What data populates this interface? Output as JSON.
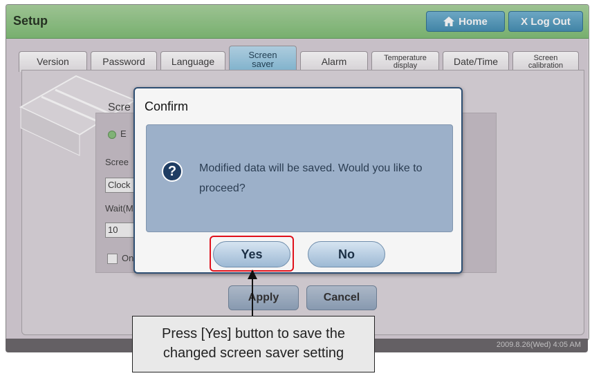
{
  "header": {
    "title": "Setup",
    "home_label": "Home",
    "logout_label": "X Log Out"
  },
  "tabs": [
    {
      "line1": "Version",
      "line2": ""
    },
    {
      "line1": "Password",
      "line2": ""
    },
    {
      "line1": "Language",
      "line2": ""
    },
    {
      "line1": "Screen",
      "line2": "saver"
    },
    {
      "line1": "Alarm",
      "line2": ""
    },
    {
      "line1": "Temperature",
      "line2": "display"
    },
    {
      "line1": "Date/Time",
      "line2": ""
    },
    {
      "line1": "Screen",
      "line2": "calibration"
    }
  ],
  "background_form": {
    "screen_label": "Scre",
    "enable_label": "E",
    "screen2_label": "Scree",
    "clock_value": "Clock",
    "wait_label": "Wait(M",
    "wait_value": "10",
    "only_label": "On",
    "apply_label": "Apply",
    "cancel_label": "Cancel"
  },
  "dialog": {
    "title": "Confirm",
    "message": "Modified data will be saved.  Would you like to proceed?",
    "yes_label": "Yes",
    "no_label": "No"
  },
  "status": {
    "datetime": "2009.8.26(Wed)  4:05 AM"
  },
  "callout": {
    "line1": "Press [Yes] button to save the",
    "line2": "changed screen saver setting"
  },
  "colors": {
    "titlebar": "#7cbd72",
    "highlight": "#e0101a",
    "dialog_body": "#9cb0c9"
  }
}
